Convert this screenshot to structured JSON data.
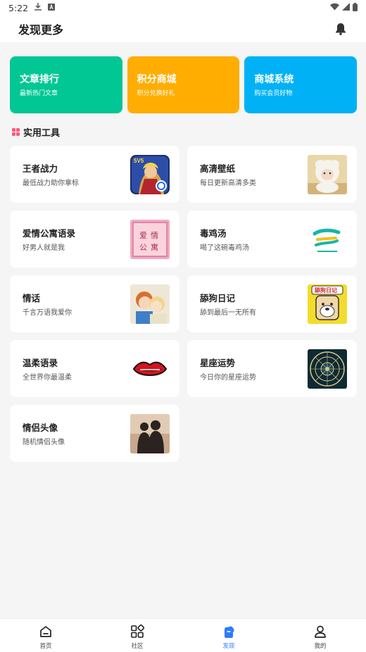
{
  "status_bar": {
    "time": "5:22"
  },
  "header": {
    "title": "发现更多"
  },
  "top_cards": [
    {
      "title": "文章排行",
      "subtitle": "最新热门文章",
      "color": "#00c794"
    },
    {
      "title": "积分商城",
      "subtitle": "积分兑换好礼",
      "color": "#ffad00"
    },
    {
      "title": "商城系统",
      "subtitle": "购买会员好物",
      "color": "#00b2f5"
    }
  ],
  "section": {
    "title": "实用工具",
    "icon": "grid-icon",
    "icon_color": "#ff5a79"
  },
  "tools": [
    {
      "name": "王者战力",
      "desc": "最低战力助你拿标",
      "thumb": "game-hero-thumb"
    },
    {
      "name": "高清壁纸",
      "desc": "每日更新高清多类",
      "thumb": "plush-sheep-thumb"
    },
    {
      "name": "爱情公寓语录",
      "desc": "好男人就是我",
      "thumb": "love-apartment-thumb"
    },
    {
      "name": "毒鸡汤",
      "desc": "喝了这碗毒鸡汤",
      "thumb": "soup-logo-thumb"
    },
    {
      "name": "情话",
      "desc": "千言万语我爱你",
      "thumb": "couple-cartoon-thumb"
    },
    {
      "name": "舔狗日记",
      "desc": "舔到最后一无所有",
      "thumb": "dog-diary-thumb"
    },
    {
      "name": "温柔语录",
      "desc": "全世界你最温柔",
      "thumb": "lips-thumb"
    },
    {
      "name": "星座运势",
      "desc": "今日你的星座运势",
      "thumb": "zodiac-wheel-thumb"
    },
    {
      "name": "情侣头像",
      "desc": "随机情侣头像",
      "thumb": "couple-silhouette-thumb"
    }
  ],
  "thumb_text": {
    "love_apartment": [
      "爱",
      "情",
      "公",
      "寓"
    ],
    "dog_diary": "舔狗日记",
    "game_badge": "5V5"
  },
  "bottom_nav": [
    {
      "label": "首页",
      "icon": "home-icon",
      "active": false
    },
    {
      "label": "社区",
      "icon": "apps-icon",
      "active": false
    },
    {
      "label": "发现",
      "icon": "discover-icon",
      "active": true
    },
    {
      "label": "我的",
      "icon": "user-icon",
      "active": false
    }
  ],
  "colors": {
    "active": "#2f7bff",
    "page_bg": "#f5f5f5"
  }
}
